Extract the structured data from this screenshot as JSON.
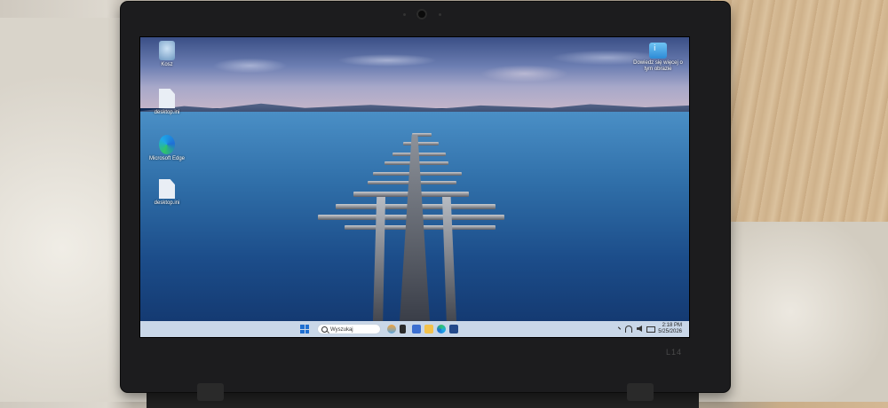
{
  "desktop": {
    "icons": [
      {
        "label": "Kosz",
        "icon": "recycle-bin-icon"
      },
      {
        "label": "desktop.ini",
        "icon": "file-icon"
      },
      {
        "label": "Microsoft Edge",
        "icon": "edge-icon"
      },
      {
        "label": "desktop.ini",
        "icon": "file-icon"
      }
    ],
    "news_widget": {
      "label": "Dowiedz się więcej o tym obrazie",
      "icon": "info-image-icon"
    }
  },
  "taskbar": {
    "search_placeholder": "Wyszukaj",
    "time": "2:18 PM",
    "date": "5/25/2026",
    "pinned": [
      "weather-icon",
      "task-view-icon",
      "widgets-icon",
      "file-explorer-icon",
      "edge-icon",
      "store-icon"
    ]
  },
  "device": {
    "model_label": "L14"
  },
  "colors": {
    "taskbar": "#d7e4f3",
    "accent": "#1f6fd1"
  }
}
